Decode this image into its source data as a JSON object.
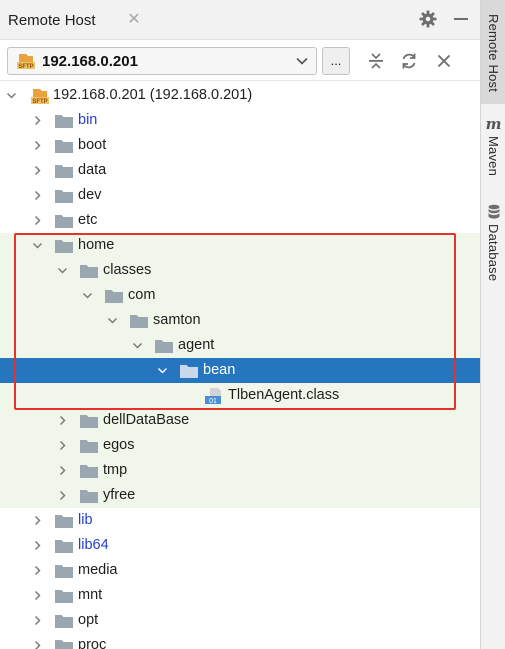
{
  "window": {
    "tab_title": "Remote Host",
    "tab_close_glyph": "✕"
  },
  "toolbar": {
    "connection_label": "192.168.0.201",
    "connection_icon": "sftp-icon",
    "sftp_badge": "SFTP",
    "more_label": "...",
    "icons": [
      "collapse-all-icon",
      "refresh-icon",
      "close-icon"
    ]
  },
  "tree": {
    "root_label": "192.168.0.201 (192.168.0.201)",
    "class_badge": "01",
    "rows": [
      {
        "label": "bin",
        "level": 1,
        "state": "collapsed",
        "type": "folder",
        "blue": true
      },
      {
        "label": "boot",
        "level": 1,
        "state": "collapsed",
        "type": "folder"
      },
      {
        "label": "data",
        "level": 1,
        "state": "collapsed",
        "type": "folder"
      },
      {
        "label": "dev",
        "level": 1,
        "state": "collapsed",
        "type": "folder"
      },
      {
        "label": "etc",
        "level": 1,
        "state": "collapsed",
        "type": "folder"
      },
      {
        "label": "home",
        "level": 1,
        "state": "expanded",
        "type": "folder",
        "hl": true
      },
      {
        "label": "classes",
        "level": 2,
        "state": "expanded",
        "type": "folder",
        "hl": true
      },
      {
        "label": "com",
        "level": 3,
        "state": "expanded",
        "type": "folder",
        "hl": true
      },
      {
        "label": "samton",
        "level": 4,
        "state": "expanded",
        "type": "folder",
        "hl": true
      },
      {
        "label": "agent",
        "level": 5,
        "state": "expanded",
        "type": "folder",
        "hl": true
      },
      {
        "label": "bean",
        "level": 6,
        "state": "expanded",
        "type": "folder",
        "selected": true
      },
      {
        "label": "TlbenAgent.class",
        "level": 7,
        "state": "leaf",
        "type": "class",
        "hl": true
      },
      {
        "label": "dellDataBase",
        "level": 2,
        "state": "collapsed",
        "type": "folder",
        "hl": true
      },
      {
        "label": "egos",
        "level": 2,
        "state": "collapsed",
        "type": "folder",
        "hl": true
      },
      {
        "label": "tmp",
        "level": 2,
        "state": "collapsed",
        "type": "folder",
        "hl": true
      },
      {
        "label": "yfree",
        "level": 2,
        "state": "collapsed",
        "type": "folder",
        "hl": true
      },
      {
        "label": "lib",
        "level": 1,
        "state": "collapsed",
        "type": "folder",
        "blue": true
      },
      {
        "label": "lib64",
        "level": 1,
        "state": "collapsed",
        "type": "folder",
        "blue": true
      },
      {
        "label": "media",
        "level": 1,
        "state": "collapsed",
        "type": "folder"
      },
      {
        "label": "mnt",
        "level": 1,
        "state": "collapsed",
        "type": "folder"
      },
      {
        "label": "opt",
        "level": 1,
        "state": "collapsed",
        "type": "folder"
      },
      {
        "label": "proc",
        "level": 1,
        "state": "collapsed",
        "type": "folder"
      }
    ]
  },
  "side_stripe": {
    "tabs": [
      {
        "label": "Remote Host",
        "icon": "",
        "active": true
      },
      {
        "label": "Maven",
        "icon": "maven-icon",
        "glyph": "m"
      },
      {
        "label": "Database",
        "icon": "database-icon"
      }
    ]
  },
  "colors": {
    "selection": "#2675bf",
    "highlight": "#f0f7ea",
    "annotation": "#e5322b",
    "folder": "#9aa7b0",
    "link_blue": "#2340c8"
  }
}
